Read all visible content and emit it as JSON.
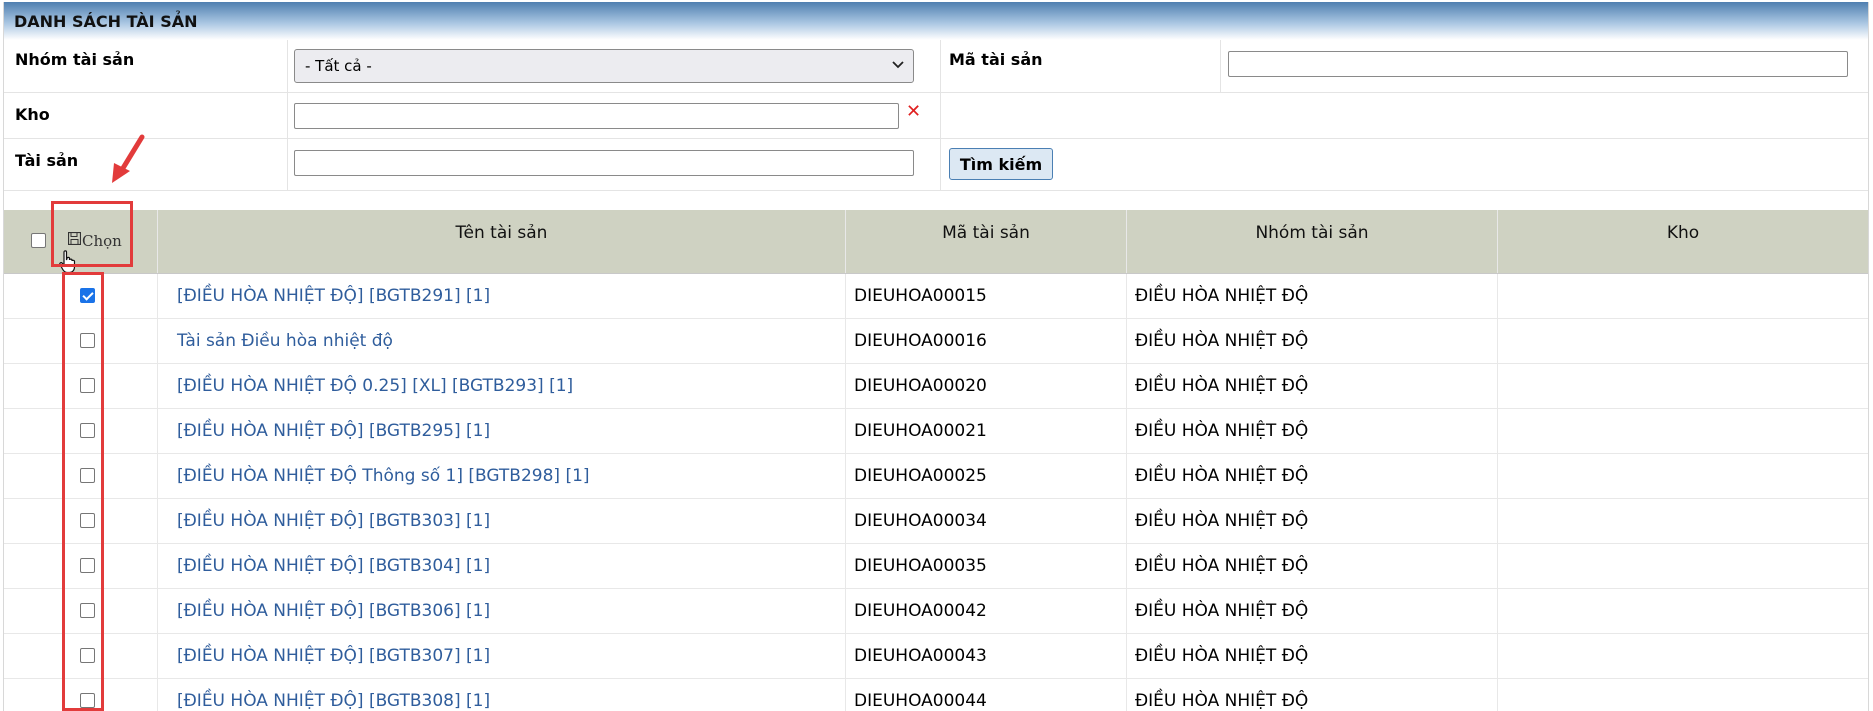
{
  "title": "DANH SÁCH TÀI SẢN",
  "filters": {
    "group_label": "Nhóm tài sản",
    "group_selected": "- Tất cả -",
    "code_label": "Mã tài sản",
    "code_value": "",
    "warehouse_label": "Kho",
    "warehouse_value": "",
    "asset_label": "Tài sản",
    "asset_value": "",
    "search_button": "Tìm kiếm"
  },
  "table": {
    "choose_label": "Chọn",
    "columns": [
      "Tên tài sản",
      "Mã tài sản",
      "Nhóm tài sản",
      "Kho"
    ],
    "rows": [
      {
        "checked": true,
        "name": "[ĐIỀU HÒA NHIỆT ĐỘ] [BGTB291] [1]",
        "code": "DIEUHOA00015",
        "group": "ĐIỀU HÒA NHIỆT ĐỘ",
        "warehouse": ""
      },
      {
        "checked": false,
        "name": "Tài sản Điều hòa nhiệt độ",
        "code": "DIEUHOA00016",
        "group": "ĐIỀU HÒA NHIỆT ĐỘ",
        "warehouse": ""
      },
      {
        "checked": false,
        "name": "[ĐIỀU HÒA NHIỆT ĐỘ 0.25] [XL] [BGTB293] [1]",
        "code": "DIEUHOA00020",
        "group": "ĐIỀU HÒA NHIỆT ĐỘ",
        "warehouse": ""
      },
      {
        "checked": false,
        "name": "[ĐIỀU HÒA NHIỆT ĐỘ] [BGTB295] [1]",
        "code": "DIEUHOA00021",
        "group": "ĐIỀU HÒA NHIỆT ĐỘ",
        "warehouse": ""
      },
      {
        "checked": false,
        "name": "[ĐIỀU HÒA NHIỆT ĐỘ Thông số 1] [BGTB298] [1]",
        "code": "DIEUHOA00025",
        "group": "ĐIỀU HÒA NHIỆT ĐỘ",
        "warehouse": ""
      },
      {
        "checked": false,
        "name": "[ĐIỀU HÒA NHIỆT ĐỘ] [BGTB303] [1]",
        "code": "DIEUHOA00034",
        "group": "ĐIỀU HÒA NHIỆT ĐỘ",
        "warehouse": ""
      },
      {
        "checked": false,
        "name": "[ĐIỀU HÒA NHIỆT ĐỘ] [BGTB304] [1]",
        "code": "DIEUHOA00035",
        "group": "ĐIỀU HÒA NHIỆT ĐỘ",
        "warehouse": ""
      },
      {
        "checked": false,
        "name": "[ĐIỀU HÒA NHIỆT ĐỘ] [BGTB306] [1]",
        "code": "DIEUHOA00042",
        "group": "ĐIỀU HÒA NHIỆT ĐỘ",
        "warehouse": ""
      },
      {
        "checked": false,
        "name": "[ĐIỀU HÒA NHIỆT ĐỘ] [BGTB307] [1]",
        "code": "DIEUHOA00043",
        "group": "ĐIỀU HÒA NHIỆT ĐỘ",
        "warehouse": ""
      },
      {
        "checked": false,
        "name": "[ĐIỀU HÒA NHIỆT ĐỘ] [BGTB308] [1]",
        "code": "DIEUHOA00044",
        "group": "ĐIỀU HÒA NHIỆT ĐỘ",
        "warehouse": ""
      }
    ]
  },
  "colors": {
    "header_bg": "#cfd2c2",
    "link": "#2f5d9c",
    "highlight": "#e23b3b",
    "checkbox_checked": "#1a73e8"
  },
  "icons": {
    "choose": "save-icon",
    "clear": "close-icon",
    "select": "chevron-down-icon",
    "cursor": "hand-pointer-icon",
    "annotation": "arrow-icon"
  }
}
